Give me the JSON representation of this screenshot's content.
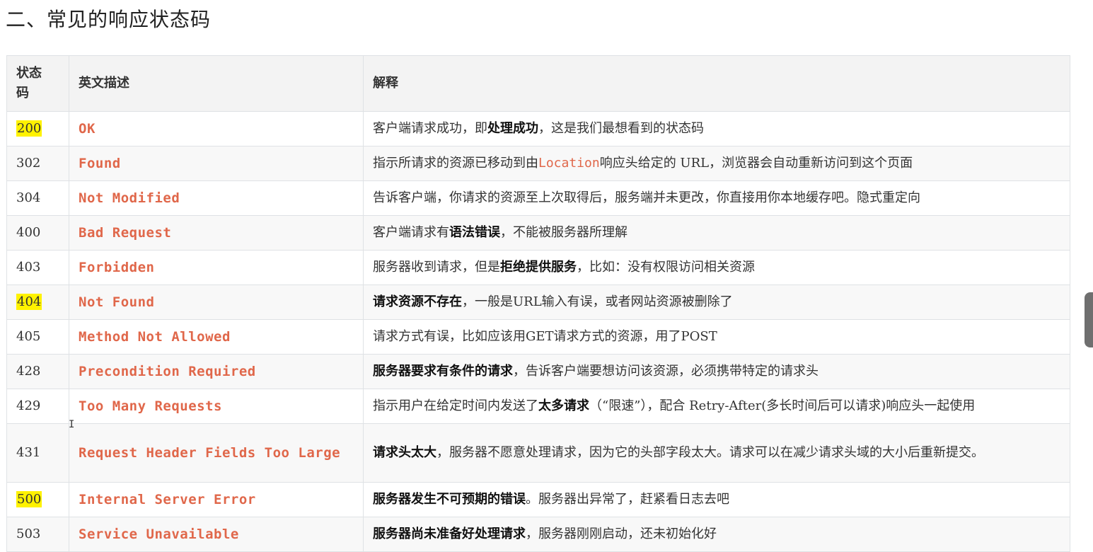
{
  "heading": "二、常见的响应状态码",
  "columns": {
    "code": "状态码",
    "desc": "英文描述",
    "expl": "解释"
  },
  "rows": [
    {
      "code": "200",
      "highlight": true,
      "desc": "OK",
      "expl": [
        {
          "t": "客户端请求成功，即"
        },
        {
          "t": "处理成功",
          "b": true
        },
        {
          "t": "，这是我们最想看到的状态码"
        }
      ]
    },
    {
      "code": "302",
      "highlight": false,
      "desc": "Found",
      "expl": [
        {
          "t": "指示所请求的资源已移动到由"
        },
        {
          "t": "Location",
          "m": true
        },
        {
          "t": "响应头给定的 URL，浏览器会自动重新访问到这个页面"
        }
      ]
    },
    {
      "code": "304",
      "highlight": false,
      "desc": "Not Modified",
      "expl": [
        {
          "t": "告诉客户端，你请求的资源至上次取得后，服务端并未更改，你直接用你本地缓存吧。隐式重定向"
        }
      ]
    },
    {
      "code": "400",
      "highlight": false,
      "desc": "Bad Request",
      "expl": [
        {
          "t": "客户端请求有"
        },
        {
          "t": "语法错误",
          "b": true
        },
        {
          "t": "，不能被服务器所理解"
        }
      ]
    },
    {
      "code": "403",
      "highlight": false,
      "desc": "Forbidden",
      "expl": [
        {
          "t": "服务器收到请求，但是"
        },
        {
          "t": "拒绝提供服务",
          "b": true
        },
        {
          "t": "，比如：没有权限访问相关资源"
        }
      ]
    },
    {
      "code": "404",
      "highlight": true,
      "desc": "Not Found",
      "expl": [
        {
          "t": "请求资源不存在",
          "b": true
        },
        {
          "t": "，一般是URL输入有误，或者网站资源被删除了"
        }
      ]
    },
    {
      "code": "405",
      "highlight": false,
      "desc": "Method Not Allowed",
      "expl": [
        {
          "t": "请求方式有误，比如应该用GET请求方式的资源，用了POST"
        }
      ]
    },
    {
      "code": "428",
      "highlight": false,
      "desc": "Precondition Required",
      "expl": [
        {
          "t": "服务器要求有条件的请求",
          "b": true
        },
        {
          "t": "，告诉客户端要想访问该资源，必须携带特定的请求头"
        }
      ]
    },
    {
      "code": "429",
      "highlight": false,
      "desc": "Too Many Requests",
      "expl": [
        {
          "t": "指示用户在给定时间内发送了"
        },
        {
          "t": "太多请求",
          "b": true
        },
        {
          "t": "（“限速”），配合 Retry-After(多长时间后可以请求)响应头一起使用"
        }
      ]
    },
    {
      "code": "431",
      "highlight": false,
      "tall": true,
      "desc": "Request Header Fields Too Large",
      "expl": [
        {
          "t": "请求头太大",
          "b": true
        },
        {
          "t": "，服务器不愿意处理请求，因为它的头部字段太大。请求可以在减少请求头域的大小后重新提交。"
        }
      ]
    },
    {
      "code": "500",
      "highlight": true,
      "desc": "Internal Server Error",
      "expl": [
        {
          "t": "服务器发生不可预期的错误",
          "b": true
        },
        {
          "t": "。服务器出异常了，赶紧看日志去吧"
        }
      ]
    },
    {
      "code": "503",
      "highlight": false,
      "desc": "Service Unavailable",
      "expl": [
        {
          "t": "服务器尚未准备好处理请求",
          "b": true
        },
        {
          "t": "，服务器刚刚启动，还未初始化好"
        }
      ]
    }
  ],
  "colors": {
    "highlight": "#fff200",
    "desc_text": "#e0674a",
    "border": "#dfe2e5",
    "header_bg": "#f3f3f3"
  }
}
